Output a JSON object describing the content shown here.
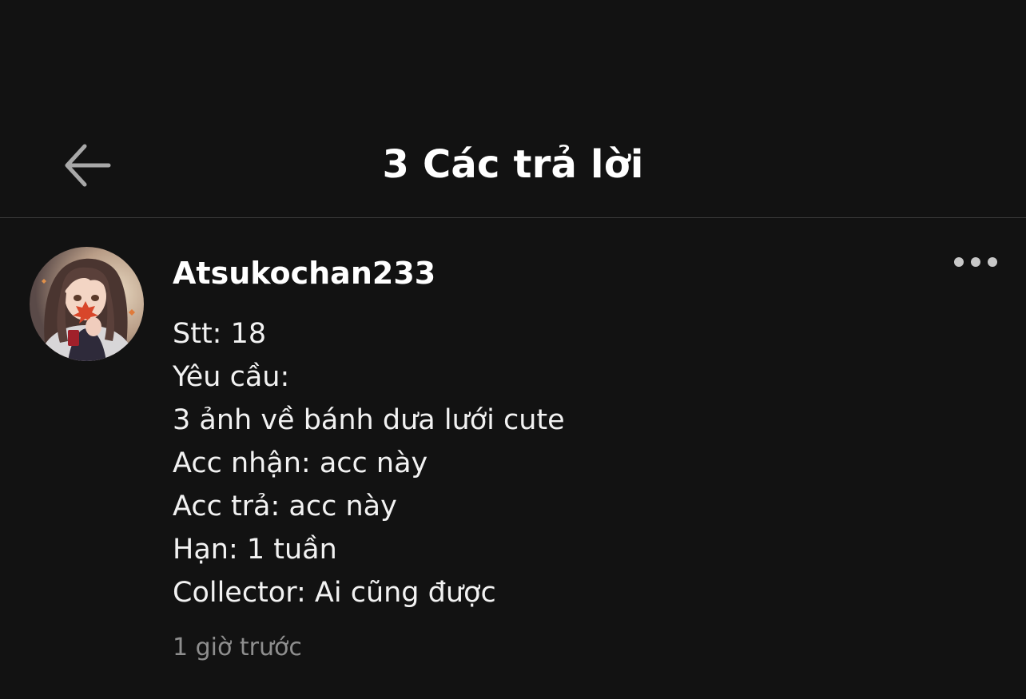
{
  "header": {
    "title": "3 Các trả lời",
    "back_icon": "back-arrow-icon"
  },
  "comment": {
    "username": "Atsukochan233",
    "avatar_icon": "user-avatar",
    "more_icon": "more-options-icon",
    "lines": [
      "Stt: 18",
      "Yêu cầu:",
      "3 ảnh về bánh dưa lưới cute",
      "Acc nhận: acc này",
      "Acc trả: acc này",
      "Hạn: 1 tuần",
      "Collector: Ai cũng được"
    ],
    "timestamp": "1 giờ trước"
  },
  "colors": {
    "background": "#121212",
    "text": "#ffffff",
    "muted": "#8e8e8e",
    "divider": "#3a3a3a"
  }
}
